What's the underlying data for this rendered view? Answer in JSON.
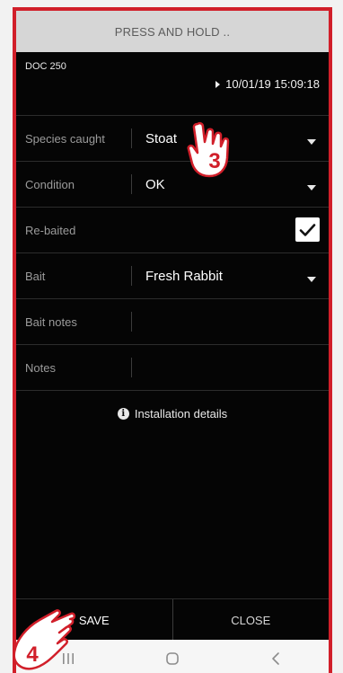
{
  "header": {
    "title": "PRESS AND HOLD .."
  },
  "record": {
    "doc_id": "DOC 250",
    "timestamp": "10/01/19 15:09:18"
  },
  "fields": [
    {
      "label": "Species caught",
      "value": "Stoat",
      "type": "dropdown"
    },
    {
      "label": "Condition",
      "value": "OK",
      "type": "dropdown"
    },
    {
      "label": "Re-baited",
      "checked": true,
      "type": "checkbox"
    },
    {
      "label": "Bait",
      "value": "Fresh Rabbit",
      "type": "dropdown"
    },
    {
      "label": "Bait notes",
      "value": "",
      "type": "text"
    },
    {
      "label": "Notes",
      "value": "",
      "type": "text"
    }
  ],
  "installation": {
    "label": "Installation details"
  },
  "actions": {
    "save": "SAVE",
    "close": "CLOSE"
  },
  "callouts": {
    "step3": "3",
    "step4": "4"
  },
  "colors": {
    "frame": "#d11f2a",
    "background": "#050505",
    "topbar": "#d6d6d6"
  }
}
